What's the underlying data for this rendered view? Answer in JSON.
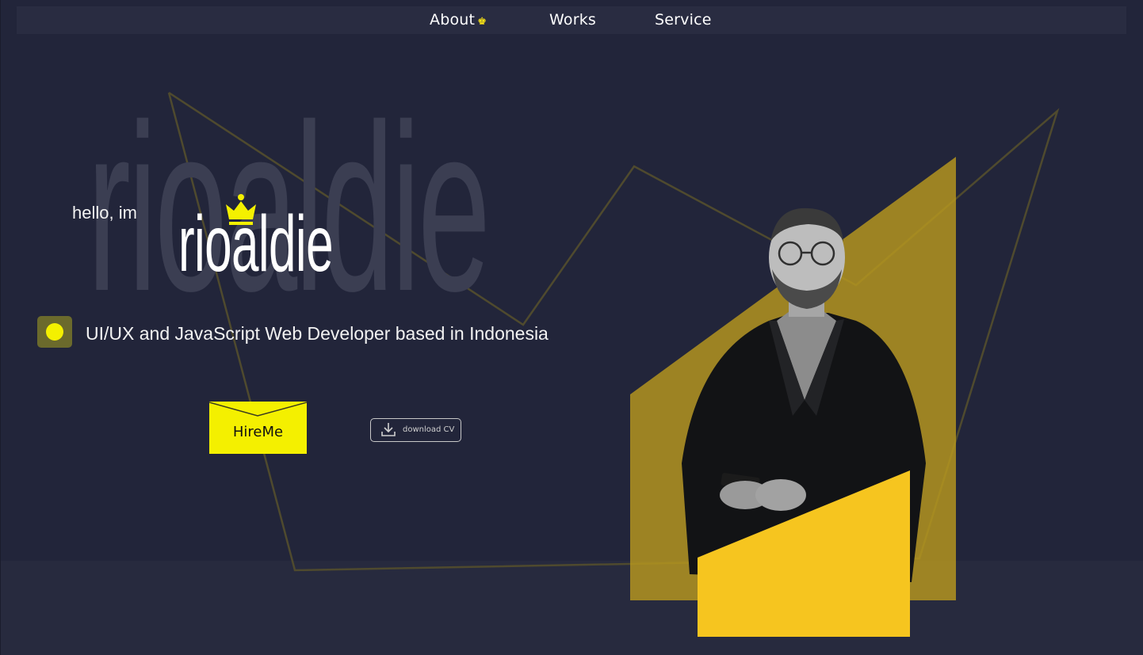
{
  "nav": {
    "items": [
      {
        "label": "About",
        "active": true
      },
      {
        "label": "Works"
      },
      {
        "label": "Service"
      }
    ],
    "active_icon": "crown-icon"
  },
  "hero": {
    "background_word": "rioaldie",
    "greeting": "hello, im",
    "name": "rioaldie",
    "tagline": "UI/UX and JavaScript Web Developer based in Indonesia"
  },
  "buttons": {
    "hire": "HireMe",
    "download_cv": "download CV",
    "download_icon": "download-icon"
  },
  "colors": {
    "background": "#22253a",
    "accent": "#f4f000",
    "gold": "#d8b21c",
    "nav_bg": "#292c41"
  }
}
